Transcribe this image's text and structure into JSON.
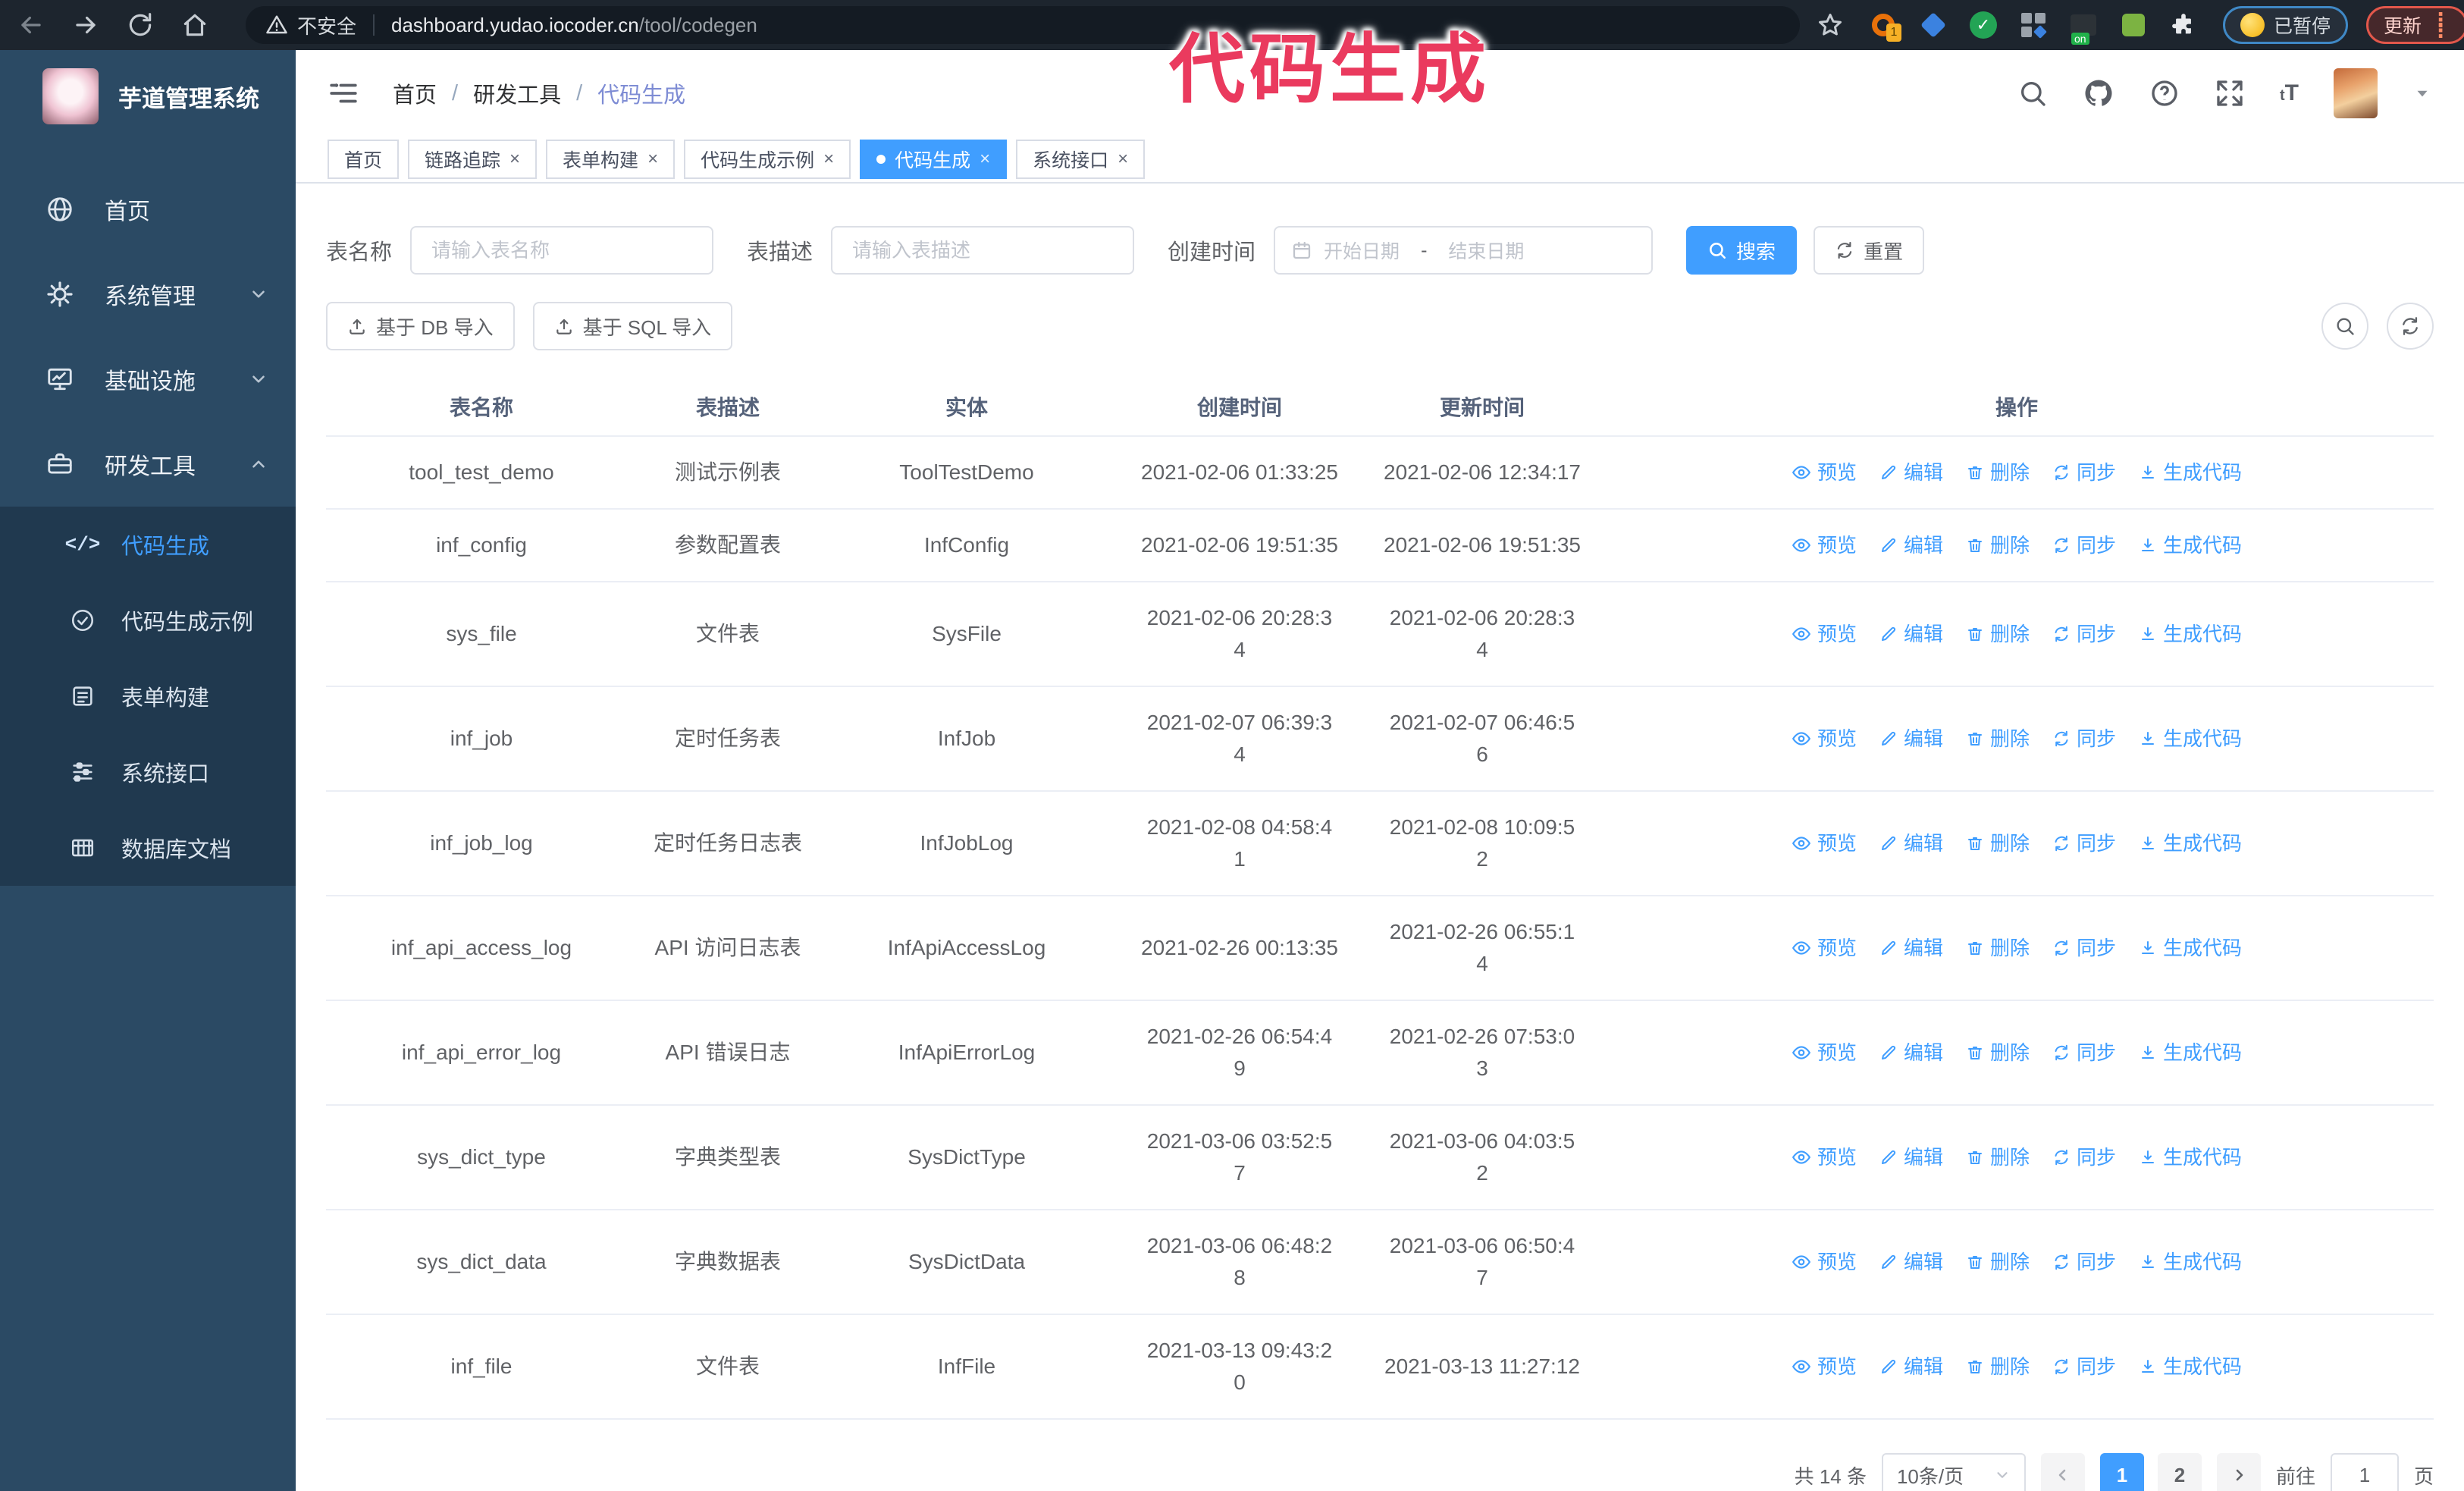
{
  "browser": {
    "security_label": "不安全",
    "url_host": "dashboard.yudao.iocoder.cn",
    "url_path": "/tool/codegen",
    "extension_badge": "1",
    "extension_on_label": "on",
    "paused_badge": "已暂停",
    "update_label": "更新"
  },
  "annotation": {
    "text": "代码生成",
    "color": "#ea3a5e"
  },
  "sidebar": {
    "title": "芋道管理系统",
    "items": [
      {
        "label": "首页"
      },
      {
        "label": "系统管理"
      },
      {
        "label": "基础设施"
      },
      {
        "label": "研发工具"
      }
    ],
    "submenu": [
      {
        "label": "代码生成",
        "active": true
      },
      {
        "label": "代码生成示例"
      },
      {
        "label": "表单构建"
      },
      {
        "label": "系统接口"
      },
      {
        "label": "数据库文档"
      }
    ]
  },
  "header": {
    "breadcrumb": [
      "首页",
      "研发工具",
      "代码生成"
    ]
  },
  "tabs": [
    {
      "label": "首页",
      "closable": false,
      "active": false
    },
    {
      "label": "链路追踪",
      "closable": true,
      "active": false
    },
    {
      "label": "表单构建",
      "closable": true,
      "active": false
    },
    {
      "label": "代码生成示例",
      "closable": true,
      "active": false
    },
    {
      "label": "代码生成",
      "closable": true,
      "active": true
    },
    {
      "label": "系统接口",
      "closable": true,
      "active": false
    }
  ],
  "filters": {
    "table_name_label": "表名称",
    "table_name_placeholder": "请输入表名称",
    "table_desc_label": "表描述",
    "table_desc_placeholder": "请输入表描述",
    "create_time_label": "创建时间",
    "start_placeholder": "开始日期",
    "range_separator": "-",
    "end_placeholder": "结束日期",
    "search_label": "搜索",
    "reset_label": "重置"
  },
  "toolbar": {
    "import_db_label": "基于 DB 导入",
    "import_sql_label": "基于 SQL 导入"
  },
  "table": {
    "columns": [
      "表名称",
      "表描述",
      "实体",
      "创建时间",
      "更新时间",
      "操作"
    ],
    "actions": [
      {
        "label": "预览",
        "icon": "eye-icon"
      },
      {
        "label": "编辑",
        "icon": "edit-icon"
      },
      {
        "label": "删除",
        "icon": "delete-icon"
      },
      {
        "label": "同步",
        "icon": "sync-icon"
      },
      {
        "label": "生成代码",
        "icon": "download-icon"
      }
    ],
    "rows": [
      {
        "name": "tool_test_demo",
        "desc": "测试示例表",
        "entity": "ToolTestDemo",
        "created": "2021-02-06 01:33:25",
        "updated": "2021-02-06 12:34:17"
      },
      {
        "name": "inf_config",
        "desc": "参数配置表",
        "entity": "InfConfig",
        "created": "2021-02-06 19:51:35",
        "updated": "2021-02-06 19:51:35"
      },
      {
        "name": "sys_file",
        "desc": "文件表",
        "entity": "SysFile",
        "created": "2021-02-06 20:28:3\n4",
        "updated": "2021-02-06 20:28:3\n4"
      },
      {
        "name": "inf_job",
        "desc": "定时任务表",
        "entity": "InfJob",
        "created": "2021-02-07 06:39:3\n4",
        "updated": "2021-02-07 06:46:5\n6"
      },
      {
        "name": "inf_job_log",
        "desc": "定时任务日志表",
        "entity": "InfJobLog",
        "created": "2021-02-08 04:58:4\n1",
        "updated": "2021-02-08 10:09:5\n2"
      },
      {
        "name": "inf_api_access_log",
        "desc": "API 访问日志表",
        "entity": "InfApiAccessLog",
        "created": "2021-02-26 00:13:35",
        "updated": "2021-02-26 06:55:1\n4"
      },
      {
        "name": "inf_api_error_log",
        "desc": "API 错误日志",
        "entity": "InfApiErrorLog",
        "created": "2021-02-26 06:54:4\n9",
        "updated": "2021-02-26 07:53:0\n3"
      },
      {
        "name": "sys_dict_type",
        "desc": "字典类型表",
        "entity": "SysDictType",
        "created": "2021-03-06 03:52:5\n7",
        "updated": "2021-03-06 04:03:5\n2"
      },
      {
        "name": "sys_dict_data",
        "desc": "字典数据表",
        "entity": "SysDictData",
        "created": "2021-03-06 06:48:2\n8",
        "updated": "2021-03-06 06:50:4\n7"
      },
      {
        "name": "inf_file",
        "desc": "文件表",
        "entity": "InfFile",
        "created": "2021-03-13 09:43:2\n0",
        "updated": "2021-03-13 11:27:12"
      }
    ]
  },
  "pagination": {
    "total_label": "共 14 条",
    "page_size_label": "10条/页",
    "pages": [
      {
        "label": "1",
        "active": true
      },
      {
        "label": "2",
        "active": false
      }
    ],
    "goto_label": "前往",
    "goto_value": "1",
    "page_unit_label": "页"
  },
  "colors": {
    "accent": "#409eff",
    "sidebar_bg": "#2b4a64",
    "submenu_bg": "#20394f",
    "annotation": "#ea3a5e"
  }
}
